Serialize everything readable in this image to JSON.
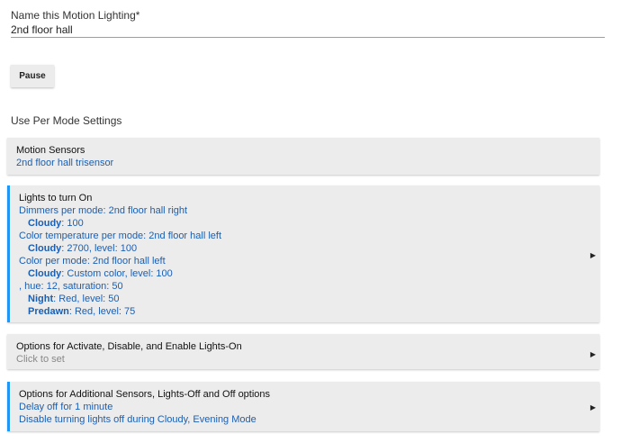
{
  "name_field": {
    "label": "Name this Motion Lighting*",
    "value": "2nd floor hall"
  },
  "pause_button": {
    "label": "Pause"
  },
  "use_per_mode_label": "Use Per Mode Settings",
  "motion_sensors": {
    "title": "Motion Sensors",
    "value": "2nd floor hall trisensor"
  },
  "lights_on": {
    "title": "Lights to turn On",
    "dimmers": "Dimmers per mode: 2nd floor hall right",
    "dimmers_cloudy_mode": "Cloudy",
    "dimmers_cloudy_value": ": 100",
    "color_temp": "Color temperature per mode: 2nd floor hall left",
    "color_temp_cloudy_mode": "Cloudy",
    "color_temp_cloudy_value": ": 2700, level: 100",
    "color": "Color per mode: 2nd floor hall left",
    "color_cloudy_mode": "Cloudy",
    "color_cloudy_value": ": Custom color, level: 100",
    "hue_line": ", hue: 12, saturation: 50",
    "night_mode": "Night",
    "night_value": ": Red, level: 50",
    "predawn_mode": "Predawn",
    "predawn_value": ": Red, level: 75"
  },
  "options_activate": {
    "title": "Options for Activate, Disable, and Enable Lights-On",
    "subtitle": "Click to set"
  },
  "options_additional": {
    "title": "Options for Additional Sensors, Lights-Off and Off options",
    "line1": "Delay off for 1 minute",
    "line2": "Disable turning lights off during Cloudy, Evening Mode"
  },
  "icons": {
    "expand": "triangle-right-icon",
    "arrow_glyph": "▶"
  },
  "colors": {
    "accent": "#2196f3",
    "link_text": "#1a5fb4",
    "card_bg": "#ececec"
  }
}
